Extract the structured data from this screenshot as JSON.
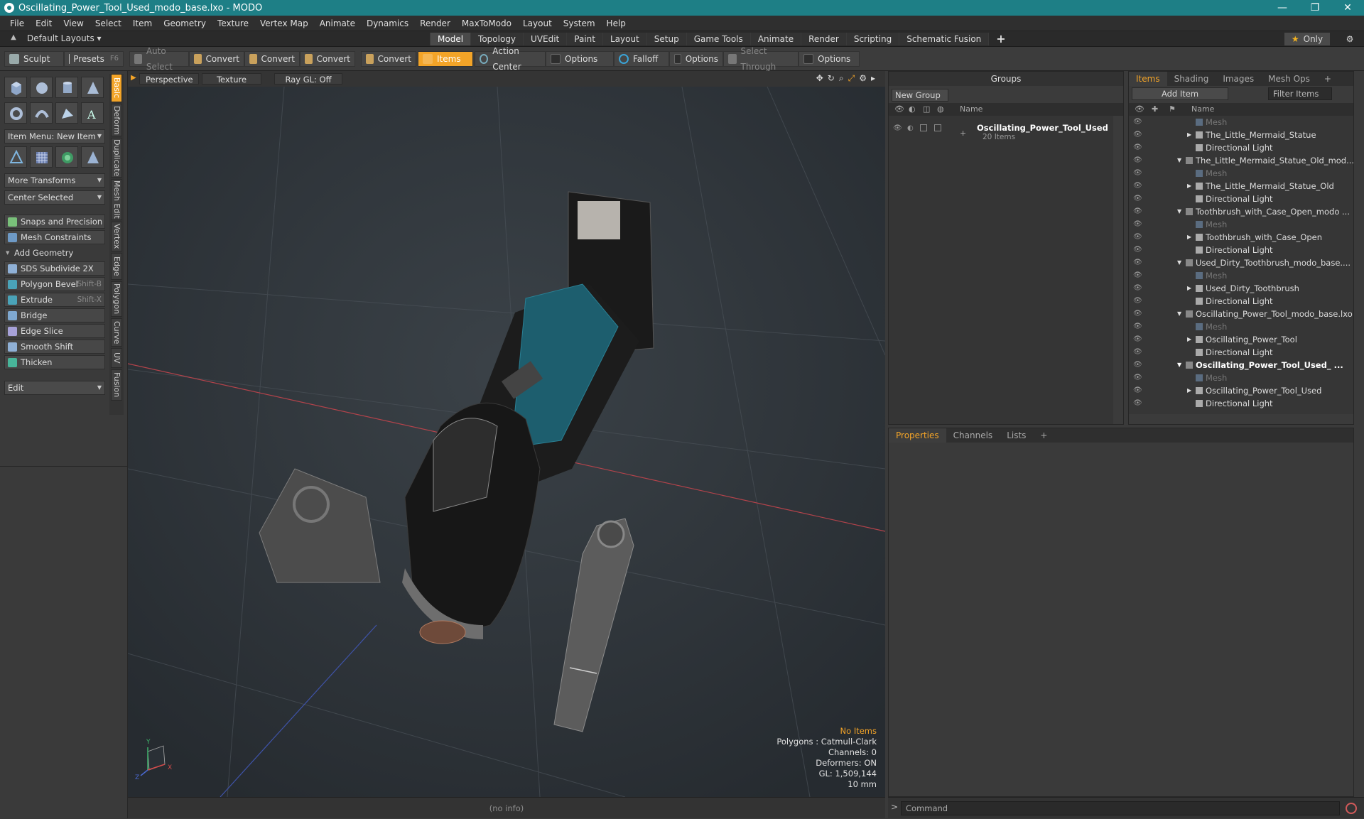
{
  "window": {
    "title": "Oscillating_Power_Tool_Used_modo_base.lxo - MODO",
    "min": "—",
    "max": "❐",
    "close": "✕"
  },
  "menu": [
    "File",
    "Edit",
    "View",
    "Select",
    "Item",
    "Geometry",
    "Texture",
    "Vertex Map",
    "Animate",
    "Dynamics",
    "Render",
    "MaxToModo",
    "Layout",
    "System",
    "Help"
  ],
  "layoutbar": {
    "default_layouts": "Default Layouts ▾",
    "tabs": [
      "Model",
      "Topology",
      "UVEdit",
      "Paint",
      "Layout",
      "Setup",
      "Game Tools",
      "Animate",
      "Render",
      "Scripting",
      "Schematic Fusion"
    ],
    "active_tab": "Model",
    "plus": "+",
    "only": "Only"
  },
  "toolbar": {
    "sculpt": "Sculpt",
    "presets": "Presets",
    "presets_key": "F6",
    "auto_select": "Auto Select",
    "convert": "Convert",
    "items": "Items",
    "action_center": "Action Center",
    "options": "Options",
    "falloff": "Falloff",
    "select_through": "Select Through"
  },
  "left": {
    "item_menu": "Item Menu: New Item",
    "more_transforms": "More Transforms",
    "center_selected": "Center Selected",
    "snaps": "Snaps and Precision",
    "mesh_constraints": "Mesh Constraints",
    "add_geometry": "Add Geometry",
    "sds": "SDS Subdivide 2X",
    "polygon_bevel": "Polygon Bevel",
    "polygon_bevel_key": "Shift-B",
    "extrude": "Extrude",
    "extrude_key": "Shift-X",
    "bridge": "Bridge",
    "edge_slice": "Edge Slice",
    "smooth_shift": "Smooth Shift",
    "thicken": "Thicken",
    "edit": "Edit",
    "vtabs": [
      "Basic",
      "Deform",
      "Duplicate",
      "Mesh Edit",
      "Vertex",
      "Edge",
      "Polygon",
      "Curve",
      "UV",
      "Fusion"
    ]
  },
  "viewport": {
    "perspective": "Perspective",
    "texture": "Texture",
    "raygl": "Ray GL: Off",
    "no_items": "No Items",
    "polygons": "Polygons : Catmull-Clark",
    "channels": "Channels: 0",
    "deformers": "Deformers: ON",
    "gl": "GL: 1,509,144",
    "scale": "10 mm",
    "axis_x": "X",
    "axis_y": "Y",
    "axis_z": "Z"
  },
  "status": {
    "info": "(no info)"
  },
  "groups": {
    "title": "Groups",
    "new_group": "New Group",
    "col_name": "Name",
    "group_name": "Oscillating_Power_Tool_Used",
    "group_count": "20 Items"
  },
  "items": {
    "tabs": [
      "Items",
      "Shading",
      "Images",
      "Mesh Ops"
    ],
    "add_item": "Add Item",
    "filter": "Filter Items",
    "col_name": "Name",
    "rows": [
      {
        "label": "Mesh",
        "indent": 3,
        "dim": true
      },
      {
        "label": "The_Little_Mermaid_Statue",
        "indent": 3,
        "arrow": "▶"
      },
      {
        "label": "Directional Light",
        "indent": 3
      },
      {
        "label": "The_Little_Mermaid_Statue_Old_mod...",
        "indent": 2,
        "arrow": "▼"
      },
      {
        "label": "Mesh",
        "indent": 3,
        "dim": true
      },
      {
        "label": "The_Little_Mermaid_Statue_Old",
        "indent": 3,
        "arrow": "▶"
      },
      {
        "label": "Directional Light",
        "indent": 3
      },
      {
        "label": "Toothbrush_with_Case_Open_modo ...",
        "indent": 2,
        "arrow": "▼"
      },
      {
        "label": "Mesh",
        "indent": 3,
        "dim": true
      },
      {
        "label": "Toothbrush_with_Case_Open",
        "indent": 3,
        "arrow": "▶"
      },
      {
        "label": "Directional Light",
        "indent": 3
      },
      {
        "label": "Used_Dirty_Toothbrush_modo_base....",
        "indent": 2,
        "arrow": "▼"
      },
      {
        "label": "Mesh",
        "indent": 3,
        "dim": true
      },
      {
        "label": "Used_Dirty_Toothbrush",
        "indent": 3,
        "arrow": "▶"
      },
      {
        "label": "Directional Light",
        "indent": 3
      },
      {
        "label": "Oscillating_Power_Tool_modo_base.lxo",
        "indent": 2,
        "arrow": "▼"
      },
      {
        "label": "Mesh",
        "indent": 3,
        "dim": true
      },
      {
        "label": "Oscillating_Power_Tool",
        "indent": 3,
        "arrow": "▶"
      },
      {
        "label": "Directional Light",
        "indent": 3
      },
      {
        "label": "Oscillating_Power_Tool_Used_ ...",
        "indent": 2,
        "arrow": "▼",
        "bold": true
      },
      {
        "label": "Mesh",
        "indent": 3,
        "dim": true
      },
      {
        "label": "Oscillating_Power_Tool_Used",
        "indent": 3,
        "arrow": "▶"
      },
      {
        "label": "Directional Light",
        "indent": 3
      }
    ]
  },
  "props": {
    "tabs": [
      "Properties",
      "Channels",
      "Lists"
    ],
    "plus": "+"
  },
  "command": {
    "placeholder": "Command",
    "prompt": ">"
  },
  "colors": {
    "titlebar": "#1e7f86",
    "accent": "#f3a428",
    "viewport": "#2b3035"
  }
}
